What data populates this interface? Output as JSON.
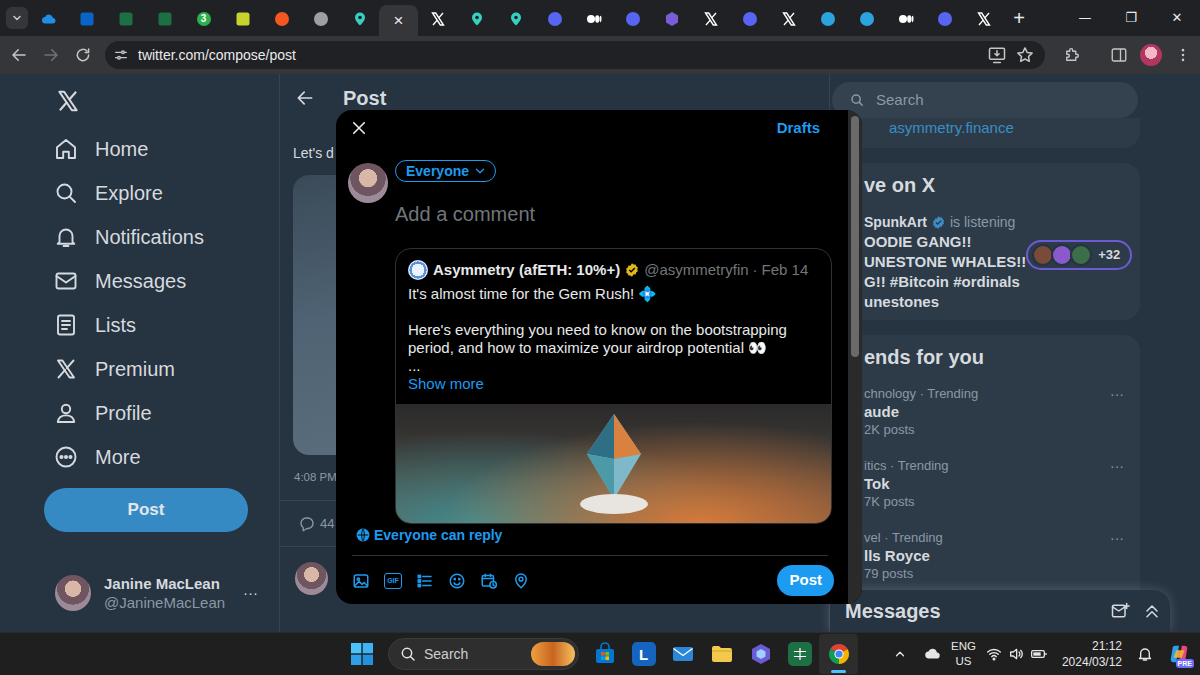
{
  "browser": {
    "tabs": [
      {
        "kind": "cloud",
        "color": "#1e8fe6",
        "selected": false
      },
      {
        "kind": "tile",
        "color": "#0a64c8",
        "selected": false
      },
      {
        "kind": "tile",
        "color": "#1d7044",
        "selected": false
      },
      {
        "kind": "tile",
        "color": "#1d7044",
        "selected": false
      },
      {
        "kind": "round",
        "color": "#2bb24c",
        "selected": false,
        "badge": "3"
      },
      {
        "kind": "tile",
        "color": "#c6d32f",
        "selected": false
      },
      {
        "kind": "round",
        "color": "#f4581f",
        "selected": false
      },
      {
        "kind": "round",
        "color": "#9aa0a6",
        "selected": false
      },
      {
        "kind": "pin",
        "color": "#35d0bf",
        "selected": false
      },
      {
        "kind": "close",
        "selected": true,
        "close": "×"
      },
      {
        "kind": "x",
        "color": "#ffffff",
        "selected": false
      },
      {
        "kind": "pin",
        "color": "#35d0bf",
        "selected": false
      },
      {
        "kind": "pin",
        "color": "#35d0bf",
        "selected": false
      },
      {
        "kind": "round",
        "color": "#5865f2",
        "selected": false
      },
      {
        "kind": "dots",
        "color": "#ffffff",
        "selected": false
      },
      {
        "kind": "round",
        "color": "#5865f2",
        "selected": false
      },
      {
        "kind": "hex",
        "color": "#7b5cd6",
        "selected": false
      },
      {
        "kind": "x",
        "color": "#ffffff",
        "selected": false
      },
      {
        "kind": "round",
        "color": "#5865f2",
        "selected": false
      },
      {
        "kind": "x",
        "color": "#ffffff",
        "selected": false
      },
      {
        "kind": "round",
        "color": "#2aa3df",
        "selected": false
      },
      {
        "kind": "round",
        "color": "#2aa3df",
        "selected": false
      },
      {
        "kind": "dots",
        "color": "#ffffff",
        "selected": false
      },
      {
        "kind": "round",
        "color": "#5865f2",
        "selected": false
      },
      {
        "kind": "x",
        "color": "#ffffff",
        "selected": false
      }
    ],
    "new_tab": "+",
    "window_controls": [
      "—",
      "❐",
      "✕"
    ],
    "url": "twitter.com/compose/post"
  },
  "sidebar": {
    "items": [
      {
        "label": "Home",
        "selected": false
      },
      {
        "label": "Explore",
        "selected": false
      },
      {
        "label": "Notifications",
        "selected": false
      },
      {
        "label": "Messages",
        "selected": false
      },
      {
        "label": "Lists",
        "selected": false
      },
      {
        "label": "Premium",
        "selected": false
      },
      {
        "label": "Profile",
        "selected": false
      },
      {
        "label": "More",
        "selected": false
      }
    ],
    "post_button": "Post",
    "account": {
      "name": "Janine MacLean",
      "handle": "@JanineMacLean",
      "more": "···"
    }
  },
  "timeline": {
    "header": "Post",
    "text": "Let's d",
    "time": "4:08 PM",
    "replies": "44"
  },
  "right": {
    "search_placeholder": "Search",
    "link": "asymmetry.finance",
    "live": {
      "title": "ve on X",
      "host": "SpunkArt",
      "status": "is listening",
      "lines": [
        "OODIE GANG!!",
        "UNESTONE WHALES!!",
        "G!! #Bitcoin #ordinals",
        "unestones"
      ],
      "count": "+32"
    },
    "trends": {
      "title": "ends for you",
      "items": [
        {
          "context": "chnology · Trending",
          "name": "aude",
          "posts": "2K posts",
          "more": "···"
        },
        {
          "context": "itics · Trending",
          "name": "Tok",
          "posts": "7K posts",
          "more": "···"
        },
        {
          "context": "vel · Trending",
          "name": "lls Royce",
          "posts": "79 posts",
          "more": "···"
        }
      ]
    },
    "messages": "Messages"
  },
  "modal": {
    "drafts": "Drafts",
    "audience": "Everyone",
    "placeholder": "Add a comment",
    "quote": {
      "name": "Asymmetry (afETH: 10%+)",
      "handle": "@asymmetryfin",
      "separator": "·",
      "date": "Feb 14",
      "paragraphs": [
        "It's almost time for the Gem Rush! 💠",
        "Here's everything you need to know on the bootstrapping period, and how to maximize your airdrop potential 👀",
        "..."
      ],
      "show_more": "Show more"
    },
    "reply_setting": "Everyone can reply",
    "gif": "GIF",
    "post_button": "Post",
    "scroll_level": 0.5
  },
  "taskbar": {
    "search": "Search",
    "apps": [
      {
        "kind": "store",
        "color": "#0078d4",
        "selected": false
      },
      {
        "kind": "tile",
        "color": "#1565c0",
        "label": "L",
        "selected": false
      },
      {
        "kind": "mail",
        "color": "#2b88d8",
        "selected": false
      },
      {
        "kind": "folder",
        "color": "#f2c94c",
        "selected": false
      },
      {
        "kind": "hex",
        "color": "#6b5bd6",
        "selected": false
      },
      {
        "kind": "tile",
        "color": "#1d7044",
        "selected": false
      },
      {
        "kind": "chrome",
        "color": "#4285f4",
        "selected": true
      }
    ],
    "tray": {
      "language": "ENG",
      "region": "US",
      "time": "21:12",
      "date": "2024/03/12",
      "copilot_badge": "PRE"
    }
  }
}
